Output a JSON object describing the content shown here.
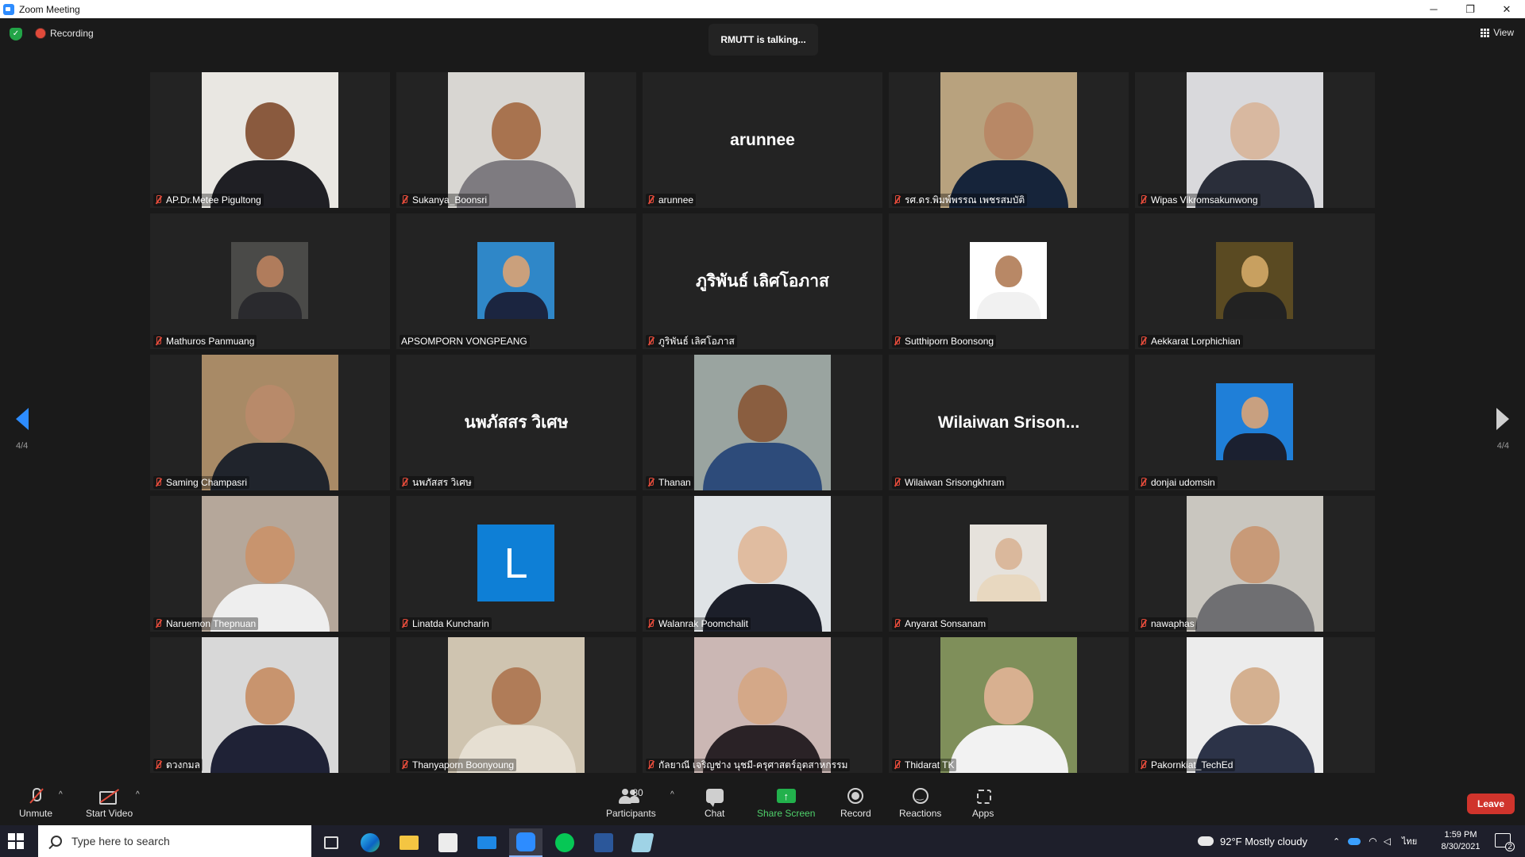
{
  "window": {
    "title": "Zoom Meeting",
    "controls": {
      "minimize": "─",
      "restore": "❐",
      "close": "✕"
    }
  },
  "topbar": {
    "recording_label": "Recording",
    "talking_label": "RMUTT is talking...",
    "view_label": "View"
  },
  "pagination": {
    "left": "4/4",
    "right": "4/4"
  },
  "participants": [
    {
      "name": "AP.Dr.Metee Pigultong",
      "kind": "photo",
      "bg": "#e9e7e2",
      "skin": "#8a5a3e",
      "cloth": "#1f1f24",
      "muted": true
    },
    {
      "name": "Sukanya_Boonsri",
      "kind": "photo",
      "bg": "#d8d6d2",
      "skin": "#a8734f",
      "cloth": "#7e7b80",
      "muted": true
    },
    {
      "name": "arunnee",
      "kind": "text",
      "display": "arunnee",
      "muted": true
    },
    {
      "name": "รศ.ดร.พิมพ์พรรณ เพชรสมบัติ",
      "kind": "photo",
      "bg": "#b8a27e",
      "skin": "#b88866",
      "cloth": "#16243a",
      "muted": true
    },
    {
      "name": "Wipas Vikromsakunwong",
      "kind": "photo",
      "bg": "#d9d9dc",
      "skin": "#d8b8a0",
      "cloth": "#2a2e3a",
      "muted": true
    },
    {
      "name": "Mathuros Panmuang",
      "kind": "small",
      "bg": "#4a4a48",
      "skin": "#b07c5c",
      "cloth": "#2a2a2e",
      "muted": true
    },
    {
      "name": "APSOMPORN VONGPEANG",
      "kind": "small",
      "bg": "#2f87c8",
      "skin": "#caa07c",
      "cloth": "#1b2540",
      "muted": false
    },
    {
      "name": "ภูริพันธ์ เลิศโอภาส",
      "kind": "text",
      "display": "ภูริพันธ์ เลิศโอภาส",
      "muted": true
    },
    {
      "name": "Sutthiporn Boonsong",
      "kind": "small",
      "bg": "#ffffff",
      "skin": "#b88866",
      "cloth": "#f1f1f1",
      "muted": true
    },
    {
      "name": "Aekkarat Lorphichian",
      "kind": "small",
      "bg": "#5a4a22",
      "skin": "#c8a060",
      "cloth": "#222222",
      "muted": true
    },
    {
      "name": "Saming Champasri",
      "kind": "photo",
      "bg": "#a88a66",
      "skin": "#b88a6a",
      "cloth": "#20242c",
      "muted": true
    },
    {
      "name": "นพภัสสร วิเศษ",
      "kind": "text",
      "display": "นพภัสสร วิเศษ",
      "muted": true
    },
    {
      "name": "Thanan",
      "kind": "photo",
      "bg": "#9aa4a0",
      "skin": "#8a5e40",
      "cloth": "#2d4b7a",
      "muted": true
    },
    {
      "name": "Wilaiwan Srisongkhram",
      "kind": "text",
      "display": "Wilaiwan  Srison...",
      "muted": true
    },
    {
      "name": "donjai udomsin",
      "kind": "small",
      "bg": "#1f7fd8",
      "skin": "#c8a080",
      "cloth": "#1b2030",
      "muted": true
    },
    {
      "name": "Naruemon Thepnuan",
      "kind": "photo",
      "bg": "#b5a79a",
      "skin": "#c8946e",
      "cloth": "#eeeeee",
      "muted": true
    },
    {
      "name": "Linatda Kuncharin",
      "kind": "letter",
      "display": "L",
      "muted": true
    },
    {
      "name": "Walanrak Poomchalit",
      "kind": "photo",
      "bg": "#dfe3e6",
      "skin": "#e0bca0",
      "cloth": "#1c1f2a",
      "muted": true
    },
    {
      "name": "Anyarat Sonsanam",
      "kind": "small",
      "bg": "#e6e2dc",
      "skin": "#dab89c",
      "cloth": "#e8d8c0",
      "muted": true
    },
    {
      "name": "nawaphas",
      "kind": "photo",
      "bg": "#c9c6bf",
      "skin": "#c89a78",
      "cloth": "#6f6f72",
      "muted": true
    },
    {
      "name": "ดวงกมล",
      "kind": "photo",
      "bg": "#d8d8d8",
      "skin": "#c8946e",
      "cloth": "#1f2236",
      "muted": true
    },
    {
      "name": "Thanyaporn Boonyoung",
      "kind": "photo",
      "bg": "#cfc4b0",
      "skin": "#b07c58",
      "cloth": "#e6dfd2",
      "muted": true
    },
    {
      "name": "กัลยาณี เจริญช่าง นุชมี-ครุศาสตร์อุตสาหกรรม",
      "kind": "photo",
      "bg": "#cbb7b4",
      "skin": "#d4a888",
      "cloth": "#2a2226",
      "muted": true
    },
    {
      "name": "Thidarat TK",
      "kind": "photo",
      "bg": "#7f8f5a",
      "skin": "#d8b090",
      "cloth": "#f2f2f2",
      "muted": true
    },
    {
      "name": "Pakornkiat_TechEd",
      "kind": "photo",
      "bg": "#ececec",
      "skin": "#d4b090",
      "cloth": "#2c3348",
      "muted": true
    }
  ],
  "toolbar": {
    "unmute_label": "Unmute",
    "start_video_label": "Start Video",
    "participants_label": "Participants",
    "participants_count": "80",
    "chat_label": "Chat",
    "share_label": "Share Screen",
    "record_label": "Record",
    "reactions_label": "Reactions",
    "apps_label": "Apps",
    "leave_label": "Leave",
    "caret": "^"
  },
  "taskbar": {
    "search_placeholder": "Type here to search",
    "weather": "92°F  Mostly cloudy",
    "lang": "ไทย",
    "time": "1:59 PM",
    "date": "8/30/2021",
    "notif_count": "2"
  },
  "colors": {
    "accent": "#2d8cff",
    "muted_red": "#e04a3a",
    "share_green": "#22b14c",
    "leave_red": "#d0342c"
  }
}
